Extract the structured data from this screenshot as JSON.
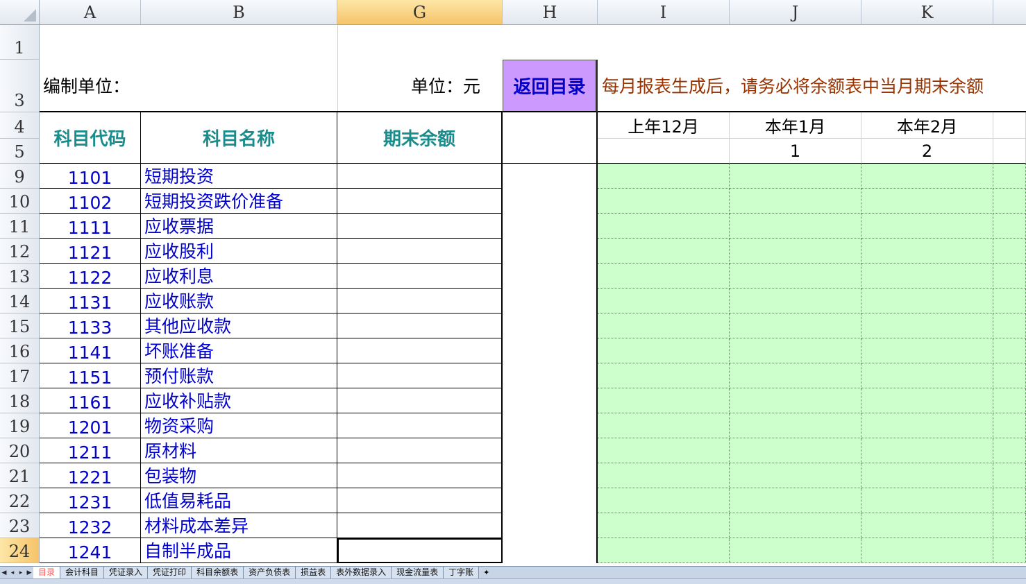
{
  "columns": [
    "A",
    "B",
    "G",
    "H",
    "I",
    "J",
    "K"
  ],
  "rows_visible": [
    "1",
    "3",
    "4",
    "5"
  ],
  "labels": {
    "org": "编制单位：",
    "unit": "单位：元",
    "back_button": "返回目录",
    "notice": "每月报表生成后，请务必将余额表中当月期末余额"
  },
  "table_headers": {
    "code": "科目代码",
    "name": "科目名称",
    "balance": "期末余额"
  },
  "periods": [
    {
      "label": "上年12月",
      "num": ""
    },
    {
      "label": "本年1月",
      "num": "1"
    },
    {
      "label": "本年2月",
      "num": "2"
    }
  ],
  "accounts": [
    {
      "row": "9",
      "code": "1101",
      "name": "短期投资"
    },
    {
      "row": "10",
      "code": "1102",
      "name": "短期投资跌价准备"
    },
    {
      "row": "11",
      "code": "1111",
      "name": "应收票据"
    },
    {
      "row": "12",
      "code": "1121",
      "name": "应收股利"
    },
    {
      "row": "13",
      "code": "1122",
      "name": "应收利息"
    },
    {
      "row": "14",
      "code": "1131",
      "name": "应收账款"
    },
    {
      "row": "15",
      "code": "1133",
      "name": "其他应收款"
    },
    {
      "row": "16",
      "code": "1141",
      "name": "坏账准备"
    },
    {
      "row": "17",
      "code": "1151",
      "name": "预付账款"
    },
    {
      "row": "18",
      "code": "1161",
      "name": "应收补贴款"
    },
    {
      "row": "19",
      "code": "1201",
      "name": "物资采购"
    },
    {
      "row": "20",
      "code": "1211",
      "name": "原材料"
    },
    {
      "row": "21",
      "code": "1221",
      "name": "包装物"
    },
    {
      "row": "22",
      "code": "1231",
      "name": "低值易耗品"
    },
    {
      "row": "23",
      "code": "1232",
      "name": "材料成本差异"
    },
    {
      "row": "24",
      "code": "1241",
      "name": "自制半成品"
    }
  ],
  "sheet_tabs": [
    "目录",
    "会计科目",
    "凭证录入",
    "凭证打印",
    "科目余额表",
    "资产负债表",
    "损益表",
    "表外数据录入",
    "现金流量表",
    "丁字账"
  ],
  "active_tab_index": 0,
  "colors": {
    "back_button_bg": "#cc99ff",
    "back_button_text": "#0000cc",
    "notice_text": "#993300",
    "header_text": "#1a8c8c",
    "account_text": "#0000d0",
    "green_fill": "#ccffcc"
  }
}
